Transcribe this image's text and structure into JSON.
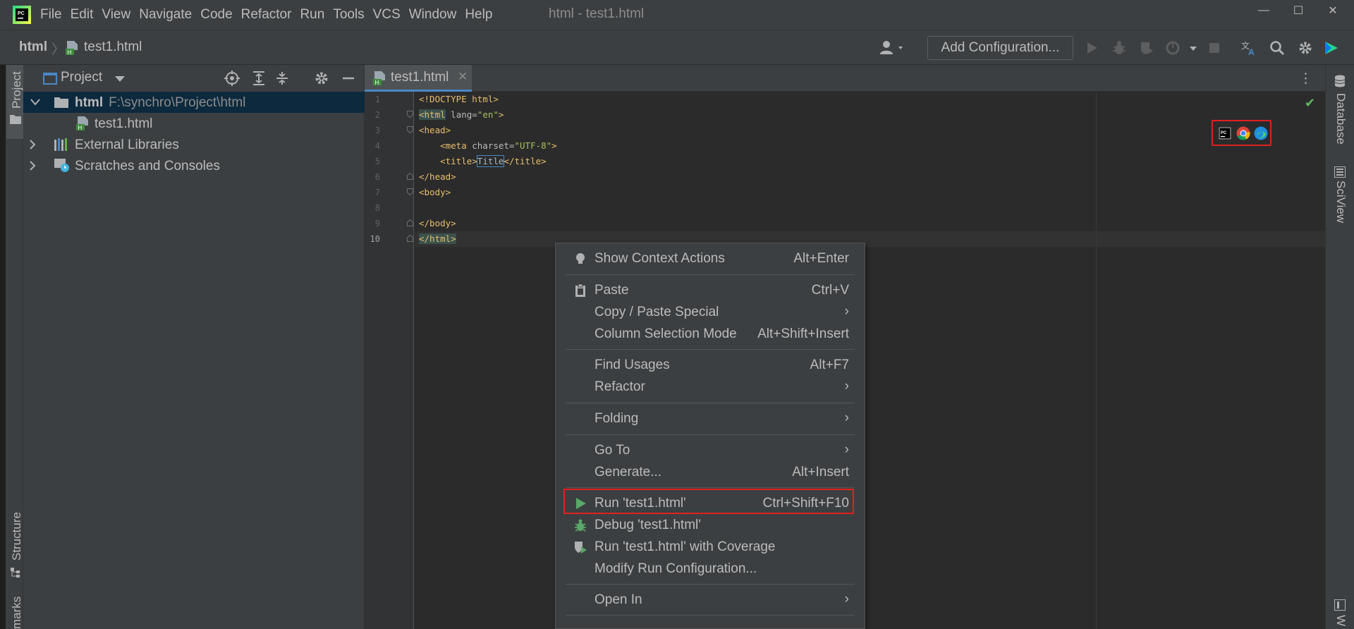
{
  "window": {
    "menu": [
      "File",
      "Edit",
      "View",
      "Navigate",
      "Code",
      "Refactor",
      "Run",
      "Tools",
      "VCS",
      "Window",
      "Help"
    ],
    "title": "html - test1.html",
    "controls": {
      "minimize": "—",
      "maximize": "☐",
      "close": "✕"
    }
  },
  "navbar": {
    "project": "html",
    "separator": "〉",
    "file": "test1.html",
    "add_configuration": "Add Configuration..."
  },
  "left_strip": {
    "tabs": [
      "Project",
      "Structure",
      "marks"
    ]
  },
  "project_panel": {
    "title": "Project",
    "tree": {
      "root": {
        "name": "html",
        "path": "F:\\synchro\\Project\\html"
      },
      "file": "test1.html",
      "external": "External Libraries",
      "scratches": "Scratches and Consoles"
    }
  },
  "editor": {
    "tab": "test1.html",
    "line_numbers": [
      "1",
      "2",
      "3",
      "4",
      "5",
      "6",
      "7",
      "8",
      "9",
      "10"
    ],
    "lines": [
      {
        "tag_open": "<!DOCTYPE html>",
        "attr": "",
        "val": "",
        "tag_close": "",
        "text": "",
        "tail": ""
      },
      {
        "tag_open": "<html",
        "attr": " lang=",
        "val": "\"en\"",
        "tag_close": ">",
        "text": "",
        "tail": ""
      },
      {
        "tag_open": "<head>",
        "attr": "",
        "val": "",
        "tag_close": "",
        "text": "",
        "tail": ""
      },
      {
        "tag_open": "    <meta",
        "attr": " charset=",
        "val": "\"UTF-8\"",
        "tag_close": ">",
        "text": "",
        "tail": ""
      },
      {
        "tag_open": "    <title>",
        "attr": "",
        "val": "",
        "tag_close": "",
        "text": "Title",
        "tail": "</title>"
      },
      {
        "tag_open": "</head>",
        "attr": "",
        "val": "",
        "tag_close": "",
        "text": "",
        "tail": ""
      },
      {
        "tag_open": "<body>",
        "attr": "",
        "val": "",
        "tag_close": "",
        "text": "",
        "tail": ""
      },
      {
        "tag_open": "",
        "attr": "",
        "val": "",
        "tag_close": "",
        "text": "",
        "tail": ""
      },
      {
        "tag_open": "</body>",
        "attr": "",
        "val": "",
        "tag_close": "",
        "text": "",
        "tail": ""
      },
      {
        "tag_open": "</html>",
        "attr": "",
        "val": "",
        "tag_close": "",
        "text": "",
        "tail": ""
      }
    ]
  },
  "right_strip": {
    "tabs": [
      "Database",
      "SciView",
      "W"
    ]
  },
  "context_menu": {
    "items": [
      {
        "label": "Show Context Actions",
        "shortcut": "Alt+Enter",
        "submenu": false
      },
      {
        "label": "Paste",
        "shortcut": "Ctrl+V",
        "submenu": false
      },
      {
        "label": "Copy / Paste Special",
        "shortcut": "",
        "submenu": true
      },
      {
        "label": "Column Selection Mode",
        "shortcut": "Alt+Shift+Insert",
        "submenu": false
      },
      {
        "label": "Find Usages",
        "shortcut": "Alt+F7",
        "submenu": false
      },
      {
        "label": "Refactor",
        "shortcut": "",
        "submenu": true
      },
      {
        "label": "Folding",
        "shortcut": "",
        "submenu": true
      },
      {
        "label": "Go To",
        "shortcut": "",
        "submenu": true
      },
      {
        "label": "Generate...",
        "shortcut": "Alt+Insert",
        "submenu": false
      },
      {
        "label": "Run 'test1.html'",
        "shortcut": "Ctrl+Shift+F10",
        "submenu": false
      },
      {
        "label": "Debug 'test1.html'",
        "shortcut": "",
        "submenu": false
      },
      {
        "label": "Run 'test1.html' with Coverage",
        "shortcut": "",
        "submenu": false
      },
      {
        "label": "Modify Run Configuration...",
        "shortcut": "",
        "submenu": false
      },
      {
        "label": "Open In",
        "shortcut": "",
        "submenu": true
      }
    ],
    "arrow_glyph": "›"
  },
  "colors": {
    "accent": "#4a88c7",
    "highlight_box": "#e02020",
    "run_green": "#59a869",
    "selection": "#0d293e"
  }
}
